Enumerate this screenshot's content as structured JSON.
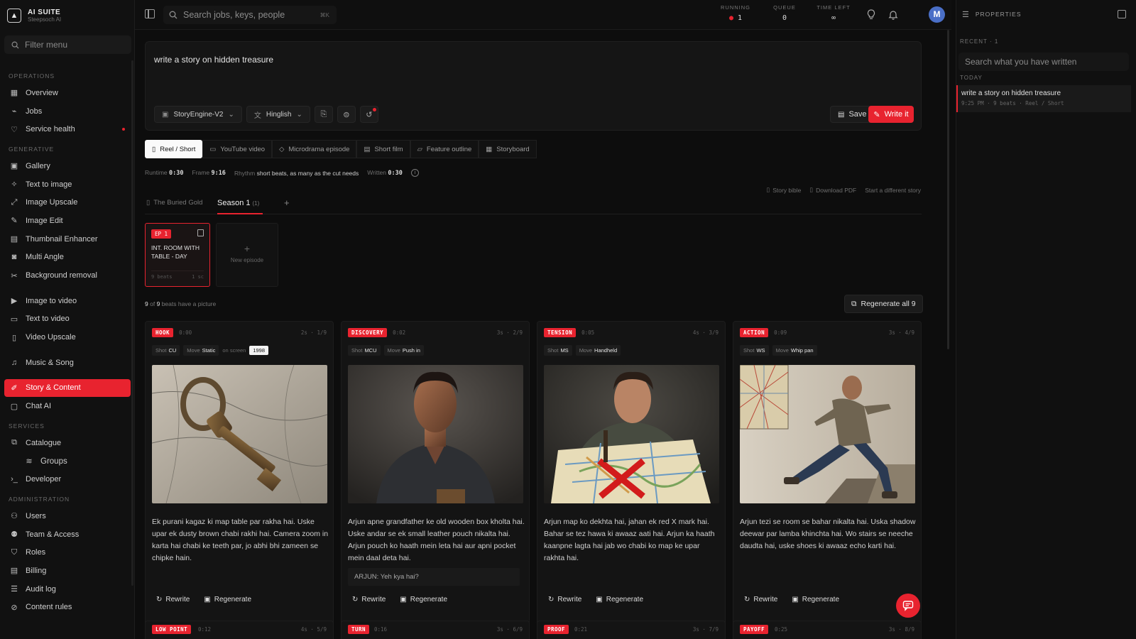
{
  "brand": {
    "name": "AI SUITE",
    "sub": "Steepsoch AI"
  },
  "sidebar": {
    "filter_placeholder": "Filter menu",
    "sections": {
      "operations": "OPERATIONS",
      "generative": "GENERATIVE",
      "services": "SERVICES",
      "administration": "ADMINISTRATION"
    },
    "items": {
      "overview": "Overview",
      "jobs": "Jobs",
      "service_health": "Service health",
      "gallery": "Gallery",
      "text_to_image": "Text to image",
      "image_upscale": "Image Upscale",
      "image_edit": "Image Edit",
      "thumbnail_enhancer": "Thumbnail Enhancer",
      "multi_angle": "Multi Angle",
      "background_removal": "Background removal",
      "image_to_video": "Image to video",
      "text_to_video": "Text to video",
      "video_upscale": "Video Upscale",
      "music_song": "Music & Song",
      "story_content": "Story & Content",
      "chat_ai": "Chat AI",
      "catalogue": "Catalogue",
      "groups": "Groups",
      "developer": "Developer",
      "users": "Users",
      "team_access": "Team & Access",
      "roles": "Roles",
      "billing": "Billing",
      "audit_log": "Audit log",
      "content_rules": "Content rules"
    }
  },
  "topbar": {
    "search_placeholder": "Search jobs, keys, people",
    "search_kbd": "⌘K",
    "stats": [
      {
        "label": "RUNNING",
        "value": "1"
      },
      {
        "label": "QUEUE",
        "value": "0"
      },
      {
        "label": "TIME LEFT",
        "value": "∞"
      }
    ],
    "avatar_initial": "M"
  },
  "properties": {
    "title": "PROPERTIES",
    "recent_label": "RECENT · 1",
    "search_placeholder": "Search what you have written",
    "today_label": "TODAY",
    "recent_item": {
      "title": "write a story on hidden treasure",
      "meta": "9:25 PM · 9 beats · Reel / Short"
    }
  },
  "composer": {
    "prompt": "write a story on hidden treasure",
    "engine": "StoryEngine-V2",
    "language": "Hinglish",
    "save_label": "Save",
    "write_label": "Write it"
  },
  "formats": [
    "Reel / Short",
    "YouTube video",
    "Microdrama episode",
    "Short film",
    "Feature outline",
    "Storyboard"
  ],
  "meta": {
    "runtime_label": "Runtime",
    "runtime": "0:30",
    "frame_label": "Frame",
    "frame": "9:16",
    "rhythm_label": "Rhythm",
    "rhythm": "short beats, as many as the cut needs",
    "written_label": "Written",
    "written": "0:30"
  },
  "links": {
    "story_bible": "Story bible",
    "download_pdf": "Download PDF",
    "start_different": "Start a different story"
  },
  "season": {
    "story_title": "The Buried Gold",
    "season_label": "Season 1",
    "count": "(1)"
  },
  "episode": {
    "badge": "EP 1",
    "title": "INT. ROOM WITH TABLE - DAY",
    "beats": "9 beats",
    "length": "1 sc"
  },
  "new_episode": "New episode",
  "beats_note": {
    "have": "9",
    "of": "of",
    "total": "9",
    "suffix": "beats have a picture"
  },
  "regen_all_label": "Regenerate all 9",
  "beats": [
    {
      "tag": "HOOK",
      "time": "0:00",
      "dur": "2s · 1/9",
      "shot": "CU",
      "move": "Static",
      "onscreen_label": "on screen",
      "onscreen": "1998",
      "text": "Ek purani kagaz ki map table par rakha hai. Uske upar ek dusty brown chabi rakhi hai. Camera zoom in karta hai chabi ke teeth par, jo abhi bhi zameen se chipke hain."
    },
    {
      "tag": "DISCOVERY",
      "time": "0:02",
      "dur": "3s · 2/9",
      "shot": "MCU",
      "move": "Push in",
      "text": "Arjun apne grandfather ke old wooden box kholta hai. Uske andar se ek small leather pouch nikalta hai. Arjun pouch ko haath mein leta hai aur apni pocket mein daal deta hai.",
      "dialog": "ARJUN: Yeh kya hai?"
    },
    {
      "tag": "TENSION",
      "time": "0:05",
      "dur": "4s · 3/9",
      "shot": "MS",
      "move": "Handheld",
      "text": "Arjun map ko dekhta hai, jahan ek red X mark hai. Bahar se tez hawa ki awaaz aati hai. Arjun ka haath kaanpne lagta hai jab wo chabi ko map ke upar rakhta hai."
    },
    {
      "tag": "ACTION",
      "time": "0:09",
      "dur": "3s · 4/9",
      "shot": "WS",
      "move": "Whip pan",
      "text": "Arjun tezi se room se bahar nikalta hai. Uska shadow deewar par lamba khinchta hai. Wo stairs se neeche daudta hai, uske shoes ki awaaz echo karti hai."
    }
  ],
  "labels": {
    "shot": "Shot",
    "move": "Move",
    "rewrite": "Rewrite",
    "regenerate": "Regenerate"
  },
  "next_beats": [
    {
      "tag": "LOW POINT",
      "time": "0:12",
      "dur": "4s · 5/9"
    },
    {
      "tag": "TURN",
      "time": "0:16",
      "dur": "3s · 6/9"
    },
    {
      "tag": "PROOF",
      "time": "0:21",
      "dur": "3s · 7/9"
    },
    {
      "tag": "PAYOFF",
      "time": "0:25",
      "dur": "3s · 8/9"
    }
  ],
  "colors": {
    "accent": "#e8232f",
    "bg": "#0d0d0d",
    "panel": "#141414"
  }
}
